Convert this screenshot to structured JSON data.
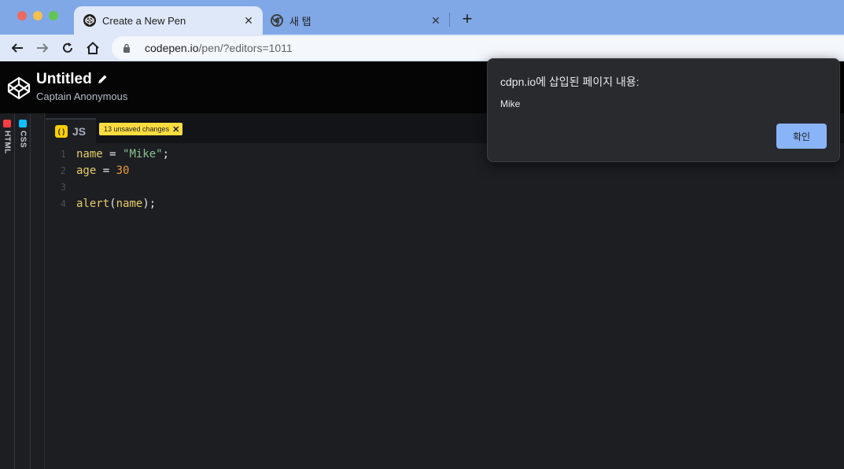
{
  "browser": {
    "tabs": [
      {
        "title": "Create a New Pen",
        "active": true,
        "icon": "codepen-icon"
      },
      {
        "title": "새 탭",
        "active": false,
        "icon": "chrome-icon"
      }
    ],
    "url_host": "codepen.io",
    "url_path": "/pen/?editors=1011"
  },
  "codepen": {
    "pen_title": "Untitled",
    "author": "Captain Anonymous",
    "collapsed_editors": [
      "HTML",
      "CSS"
    ],
    "js_tab_label": "JS",
    "js_icon_text": "( )",
    "unsaved_badge": "13 unsaved changes",
    "code_lines": [
      {
        "num": "1",
        "tokens": [
          {
            "t": "name",
            "c": "c-var"
          },
          {
            "t": " = ",
            "c": "c-op"
          },
          {
            "t": "\"Mike\"",
            "c": "c-str"
          },
          {
            "t": ";",
            "c": "c-op"
          }
        ]
      },
      {
        "num": "2",
        "tokens": [
          {
            "t": "age",
            "c": "c-var"
          },
          {
            "t": " = ",
            "c": "c-op"
          },
          {
            "t": "30",
            "c": "c-num"
          }
        ]
      },
      {
        "num": "3",
        "tokens": []
      },
      {
        "num": "4",
        "tokens": [
          {
            "t": "alert",
            "c": "c-fn"
          },
          {
            "t": "(",
            "c": "c-op"
          },
          {
            "t": "name",
            "c": "c-var"
          },
          {
            "t": ");",
            "c": "c-op"
          }
        ]
      }
    ]
  },
  "dialog": {
    "title": "cdpn.io에 삽입된 페이지 내용:",
    "message": "Mike",
    "ok_label": "확인"
  },
  "colors": {
    "titlebar": "#80a8e6",
    "toolbar": "#dee8f8",
    "js_accent": "#fcd000",
    "html_accent": "#ff3c41",
    "css_accent": "#0ebeff",
    "dialog_button": "#8ab4f8"
  }
}
